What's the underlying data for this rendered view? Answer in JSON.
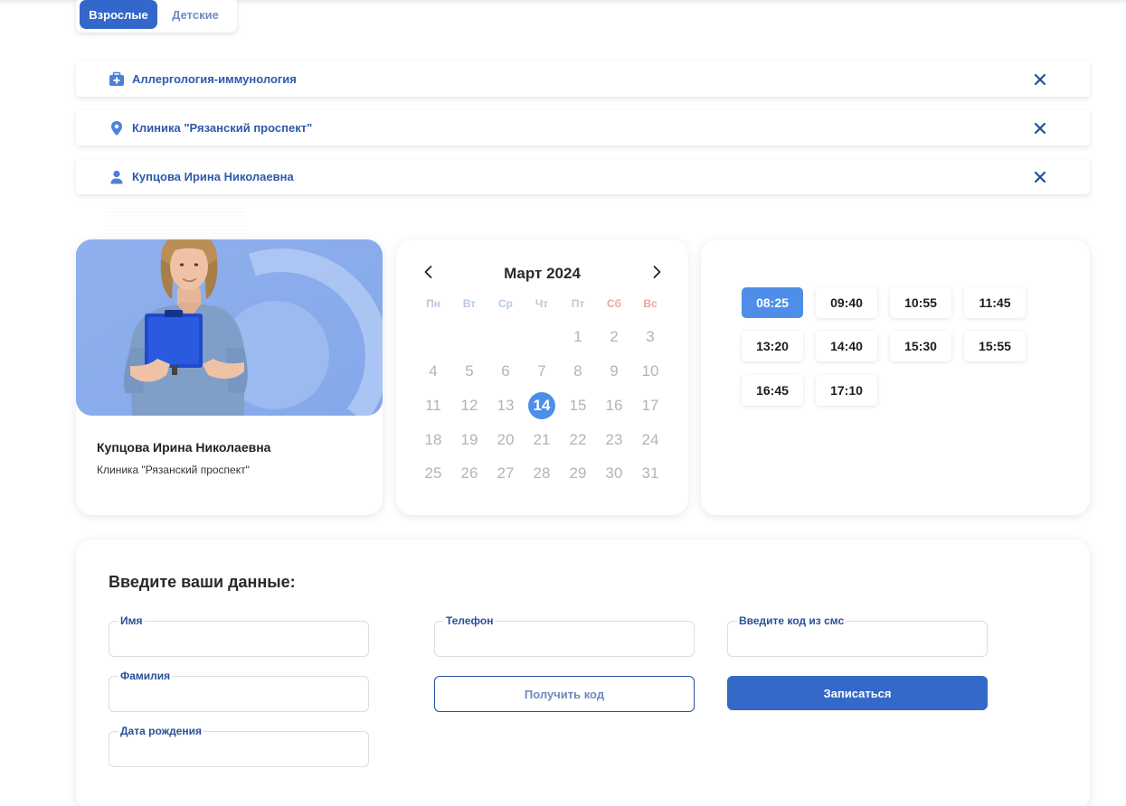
{
  "tabs": {
    "adults": "Взрослые",
    "children": "Детские"
  },
  "filters": {
    "specialty": "Аллергология-иммунология",
    "clinic": "Клиника \"Рязанский проспект\"",
    "doctor": "Купцова Ирина Николаевна"
  },
  "doctor_card": {
    "name": "Купцова Ирина Николаевна",
    "clinic": "Клиника \"Рязанский проспект\""
  },
  "calendar": {
    "month": "Март 2024",
    "weekdays": [
      "Пн",
      "Вт",
      "Ср",
      "Чт",
      "Пт",
      "Сб",
      "Вс"
    ],
    "weeks": [
      [
        "",
        "",
        "",
        "",
        "1",
        "2",
        "3"
      ],
      [
        "4",
        "5",
        "6",
        "7",
        "8",
        "9",
        "10"
      ],
      [
        "11",
        "12",
        "13",
        "14",
        "15",
        "16",
        "17"
      ],
      [
        "18",
        "19",
        "20",
        "21",
        "22",
        "23",
        "24"
      ],
      [
        "25",
        "26",
        "27",
        "28",
        "29",
        "30",
        "31"
      ]
    ],
    "selected_day": "14"
  },
  "slots": [
    "08:25",
    "09:40",
    "10:55",
    "11:45",
    "13:20",
    "14:40",
    "15:30",
    "15:55",
    "16:45",
    "17:10"
  ],
  "selected_slot": "08:25",
  "form": {
    "title": "Введите ваши данные:",
    "first_name_label": "Имя",
    "last_name_label": "Фамилия",
    "birth_date_label": "Дата рождения",
    "phone_label": "Телефон",
    "sms_code_label": "Введите код из смс",
    "get_code_button": "Получить код",
    "submit_button": "Записаться"
  },
  "colors": {
    "accent": "#3467cb",
    "selected": "#4f8ee8",
    "label": "#2e59aa",
    "photo_bg": "#8caeed"
  }
}
